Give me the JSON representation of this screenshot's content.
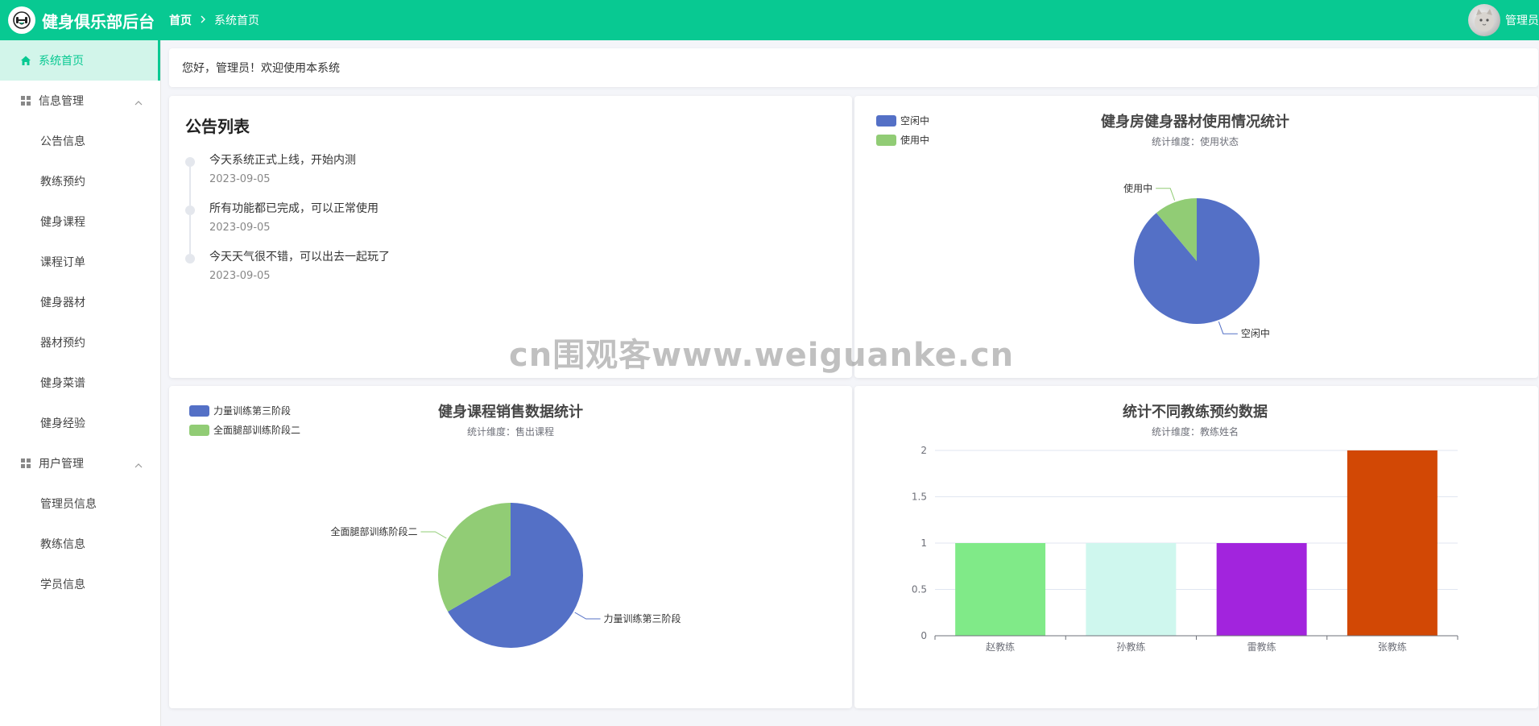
{
  "header": {
    "app_title": "健身俱乐部后台",
    "breadcrumb": [
      "首页",
      "系统首页"
    ],
    "user_name": "管理员"
  },
  "sidebar": {
    "home": "系统首页",
    "groups": [
      {
        "label": "信息管理",
        "items": [
          "公告信息",
          "教练预约",
          "健身课程",
          "课程订单",
          "健身器材",
          "器材预约",
          "健身菜谱",
          "健身经验"
        ]
      },
      {
        "label": "用户管理",
        "items": [
          "管理员信息",
          "教练信息",
          "学员信息"
        ]
      }
    ]
  },
  "welcome": "您好，管理员！欢迎使用本系统",
  "notice": {
    "title": "公告列表",
    "items": [
      {
        "text": "今天系统正式上线，开始内测",
        "date": "2023-09-05"
      },
      {
        "text": "所有功能都已完成，可以正常使用",
        "date": "2023-09-05"
      },
      {
        "text": "今天天气很不错，可以出去一起玩了",
        "date": "2023-09-05"
      }
    ]
  },
  "watermark": "cn围观客www.weiguanke.cn",
  "colors": {
    "primary": "#08c992",
    "active_bg": "#d2f5ea"
  },
  "chart_data": [
    {
      "type": "pie",
      "title": "健身房健身器材使用情况统计",
      "subtitle": "统计维度：使用状态",
      "legend_position": "top-left",
      "slices": [
        {
          "name": "空闲中",
          "value": 8,
          "color": "#5470c6"
        },
        {
          "name": "使用中",
          "value": 1,
          "color": "#91cc75"
        }
      ]
    },
    {
      "type": "pie",
      "title": "健身课程销售数据统计",
      "subtitle": "统计维度：售出课程",
      "legend_position": "top-left",
      "slices": [
        {
          "name": "力量训练第三阶段",
          "value": 2,
          "color": "#5470c6"
        },
        {
          "name": "全面腿部训练阶段二",
          "value": 1,
          "color": "#91cc75"
        }
      ]
    },
    {
      "type": "bar",
      "title": "统计不同教练预约数据",
      "subtitle": "统计维度：教练姓名",
      "categories": [
        "赵教练",
        "孙教练",
        "雷教练",
        "张教练"
      ],
      "values": [
        1,
        1,
        1,
        2
      ],
      "colors": [
        "#80ea88",
        "#cff7ee",
        "#a224dd",
        "#d24805"
      ],
      "ylim": [
        0,
        2
      ],
      "yticks": [
        "0",
        "0.5",
        "1",
        "1.5",
        "2"
      ],
      "grid": true
    }
  ]
}
